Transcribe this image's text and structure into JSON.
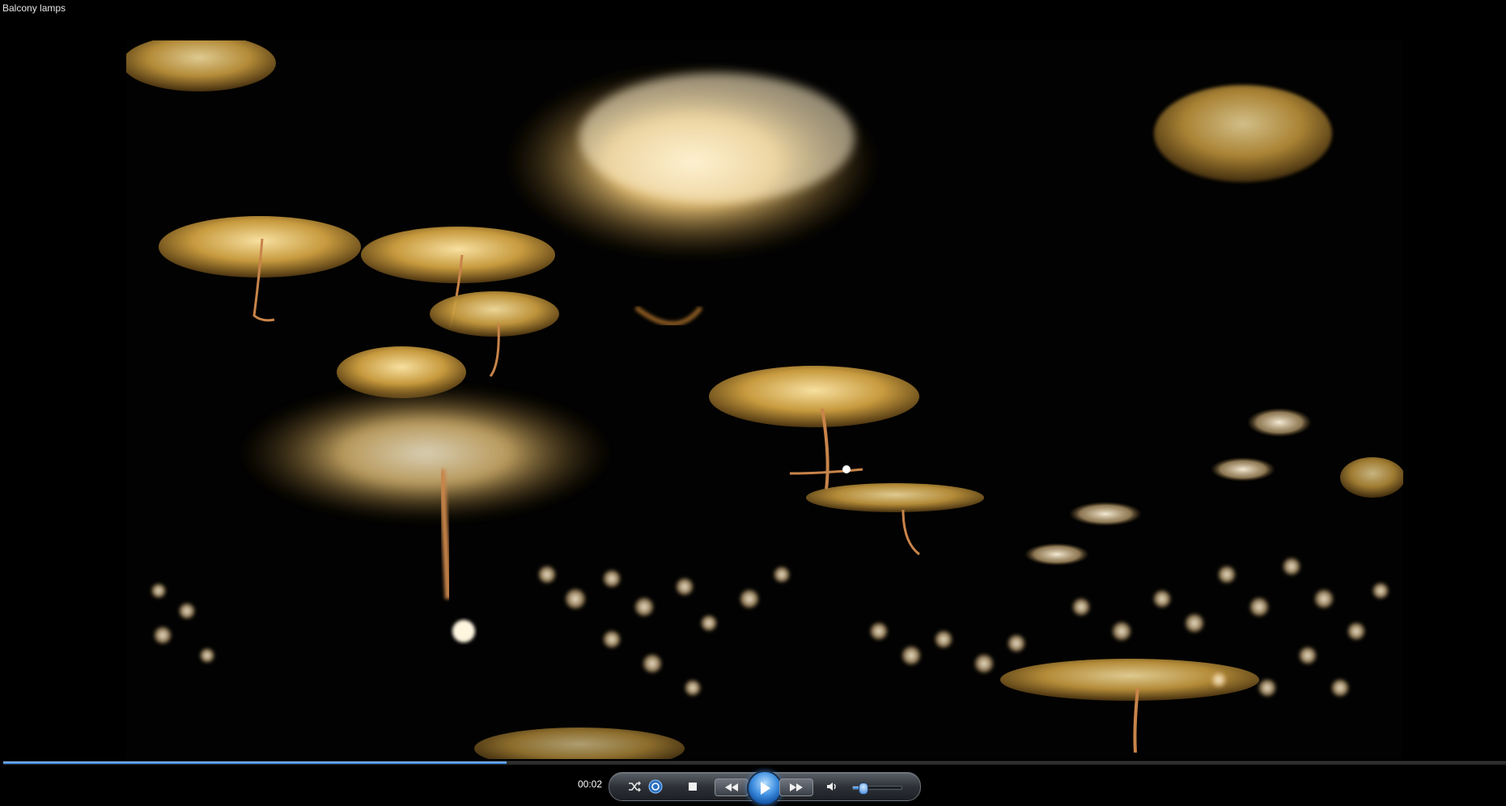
{
  "window": {
    "title": "Balcony lamps"
  },
  "player": {
    "elapsed_time": "00:02",
    "progress_fraction": 0.335,
    "volume_fraction": 0.2,
    "accent_color": "#2a79d6"
  },
  "controls": {
    "shuffle_icon": "shuffle-icon",
    "repeat_icon": "repeat-icon",
    "stop_icon": "stop-icon",
    "previous_icon": "previous-icon",
    "play_icon": "play-icon",
    "next_icon": "next-icon",
    "mute_icon": "speaker-icon"
  }
}
